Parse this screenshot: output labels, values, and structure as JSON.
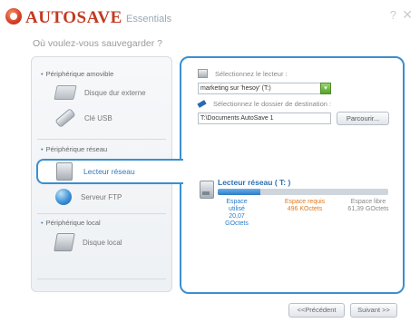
{
  "header": {
    "app_name": "AUTOSAVE",
    "edition": "Essentials",
    "help_symbol": "?",
    "close_symbol": "✕"
  },
  "question": "Où voulez-vous sauvegarder ?",
  "sidebar": {
    "sections": [
      {
        "title": "Périphérique amovible",
        "items": [
          {
            "label": "Disque dur externe",
            "icon": "external-drive-icon"
          },
          {
            "label": "Clé USB",
            "icon": "usb-key-icon"
          }
        ]
      },
      {
        "title": "Périphérique réseau",
        "items": [
          {
            "label": "Lecteur réseau",
            "icon": "network-drive-icon",
            "selected": true
          },
          {
            "label": "Serveur FTP",
            "icon": "ftp-globe-icon"
          }
        ]
      },
      {
        "title": "Périphérique local",
        "items": [
          {
            "label": "Disque local",
            "icon": "local-disk-icon"
          }
        ]
      }
    ]
  },
  "main": {
    "select_drive_label": "Sélectionnez le lecteur :",
    "selected_drive": "marketing sur 'hesoy' (T:)",
    "select_folder_label": "Sélectionnez le dossier de destination :",
    "destination_path": "T:\\Documents AutoSave 1",
    "browse_label": "Parcourir...",
    "drive_title": "Lecteur réseau ( T: )",
    "used_fraction": 0.25,
    "stats": {
      "used_label": "Espace utilisé",
      "used_value": "20,07",
      "used_unit": "GOctets",
      "required_label": "Espace requis",
      "required_value": "496 KOctets",
      "free_label": "Espace libre",
      "free_value": "61,39 GOctets"
    },
    "colors": {
      "used": "#2a7bc7",
      "required": "#e07a1f",
      "free": "#888888"
    }
  },
  "footer": {
    "previous_label": "<<Précédent",
    "next_label": "Suivant >>"
  }
}
